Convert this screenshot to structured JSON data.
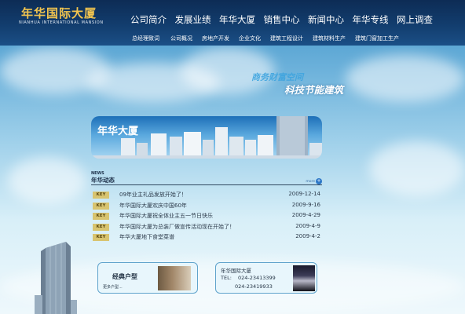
{
  "header": {
    "logo_title": "年华国际大厦",
    "logo_subtitle": "NIANHUA INTERNATIONAL MANSION",
    "nav": [
      "公司简介",
      "发展业绩",
      "年华大厦",
      "销售中心",
      "新闻中心",
      "年华专线",
      "网上调查"
    ],
    "subnav": [
      "总经理致词",
      "公司概况",
      "房地产开发",
      "企业文化",
      "建筑工程设计",
      "建筑材料生产",
      "建筑门窗加工生产"
    ]
  },
  "slogan": {
    "line1": "商务财富空间",
    "line2": "科技节能建筑"
  },
  "banner": {
    "title": "年华大厦"
  },
  "news": {
    "label_en": "NEWS",
    "label_cn": "年华动态",
    "more": "more",
    "items": [
      {
        "badge": "KEY",
        "title": "09年业主礼品发放开始了！",
        "date": "2009-12-14"
      },
      {
        "badge": "KEY",
        "title": "年华国际大厦欢庆中国60年",
        "date": "2009-9-16"
      },
      {
        "badge": "KEY",
        "title": "年华国际大厦祝全体业主五一节日快乐",
        "date": "2009-4-29"
      },
      {
        "badge": "KEY",
        "title": "年华国际大厦为总装厂做宣传活动现在开始了！",
        "date": "2009-4-9"
      },
      {
        "badge": "KEY",
        "title": "年华大厦地下食堂菜谱",
        "date": "2009-4-2"
      }
    ]
  },
  "cards": {
    "classic": {
      "title": "经典户型",
      "more": "更多户型..."
    },
    "contact": {
      "name": "年华国际大厦",
      "tel_label": "TEL:",
      "tel1": "024-23413399",
      "tel2": "024-23419933"
    }
  },
  "colors": {
    "header_bg": "#123d6e",
    "logo_gold": "#f1c44f",
    "badge": "#d8c470",
    "sky": "#6db2db"
  }
}
